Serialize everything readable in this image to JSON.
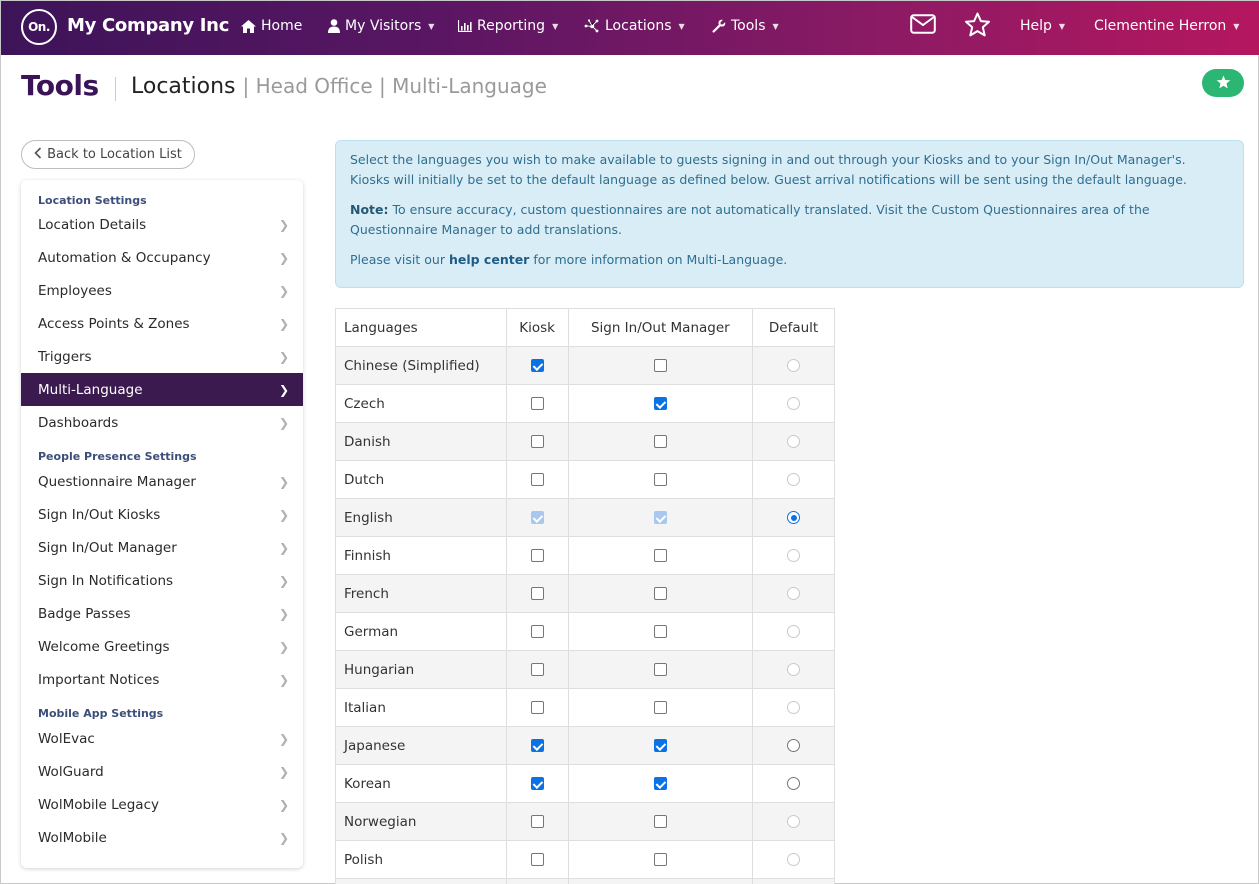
{
  "nav": {
    "logo_text": "On.",
    "brand": "My Company Inc",
    "items": [
      {
        "label": "Home",
        "icon": "home-icon"
      },
      {
        "label": "My Visitors",
        "icon": "user-icon"
      },
      {
        "label": "Reporting",
        "icon": "chart-icon"
      },
      {
        "label": "Locations",
        "icon": "network-icon"
      },
      {
        "label": "Tools",
        "icon": "wrench-icon"
      }
    ],
    "help": "Help",
    "user": "Clementine Herron"
  },
  "header": {
    "title": "Tools",
    "crumb_main": "Locations",
    "crumb_rest": "| Head Office | Multi-Language"
  },
  "back_button": "Back to Location List",
  "sidebar": {
    "sections": [
      {
        "title": "Location Settings",
        "items": [
          "Location Details",
          "Automation & Occupancy",
          "Employees",
          "Access Points & Zones",
          "Triggers",
          "Multi-Language",
          "Dashboards"
        ]
      },
      {
        "title": "People Presence Settings",
        "items": [
          "Questionnaire Manager",
          "Sign In/Out Kiosks",
          "Sign In/Out Manager",
          "Sign In Notifications",
          "Badge Passes",
          "Welcome Greetings",
          "Important Notices"
        ]
      },
      {
        "title": "Mobile App Settings",
        "items": [
          "WolEvac",
          "WolGuard",
          "WolMobile Legacy",
          "WolMobile"
        ]
      }
    ],
    "active": "Multi-Language"
  },
  "info": {
    "line1": "Select the languages you wish to make available to guests signing in and out through your Kiosks and to your Sign In/Out Manager's. Kiosks will initially be set to the default language as defined below. Guest arrival notifications will be sent using the default language.",
    "note_label": "Note:",
    "note_text": "To ensure accuracy, custom questionnaires are not automatically translated. Visit the Custom Questionnaires area of the Questionnaire Manager to add translations.",
    "visit_pre": "Please visit our",
    "visit_link": "help center",
    "visit_post": "for more information on Multi-Language."
  },
  "table": {
    "headers": [
      "Languages",
      "Kiosk",
      "Sign In/Out Manager",
      "Default"
    ],
    "rows": [
      {
        "lang": "Chinese (Simplified)",
        "kiosk": "on",
        "manager": "off",
        "default": "disabled"
      },
      {
        "lang": "Czech",
        "kiosk": "off",
        "manager": "on",
        "default": "disabled"
      },
      {
        "lang": "Danish",
        "kiosk": "off",
        "manager": "off",
        "default": "disabled"
      },
      {
        "lang": "Dutch",
        "kiosk": "off",
        "manager": "off",
        "default": "disabled"
      },
      {
        "lang": "English",
        "kiosk": "locked",
        "manager": "locked",
        "default": "selected"
      },
      {
        "lang": "Finnish",
        "kiosk": "off",
        "manager": "off",
        "default": "disabled"
      },
      {
        "lang": "French",
        "kiosk": "off",
        "manager": "off",
        "default": "disabled"
      },
      {
        "lang": "German",
        "kiosk": "off",
        "manager": "off",
        "default": "disabled"
      },
      {
        "lang": "Hungarian",
        "kiosk": "off",
        "manager": "off",
        "default": "disabled"
      },
      {
        "lang": "Italian",
        "kiosk": "off",
        "manager": "off",
        "default": "disabled"
      },
      {
        "lang": "Japanese",
        "kiosk": "on",
        "manager": "on",
        "default": "enabled"
      },
      {
        "lang": "Korean",
        "kiosk": "on",
        "manager": "on",
        "default": "enabled"
      },
      {
        "lang": "Norwegian",
        "kiosk": "off",
        "manager": "off",
        "default": "disabled"
      },
      {
        "lang": "Polish",
        "kiosk": "off",
        "manager": "off",
        "default": "disabled"
      }
    ]
  },
  "colors": {
    "accent_purple": "#3b1457",
    "active_item": "#3b1a4f",
    "fav_green": "#2bb673",
    "info_bg": "#d9edf7",
    "checkbox_blue": "#0b72e4"
  }
}
